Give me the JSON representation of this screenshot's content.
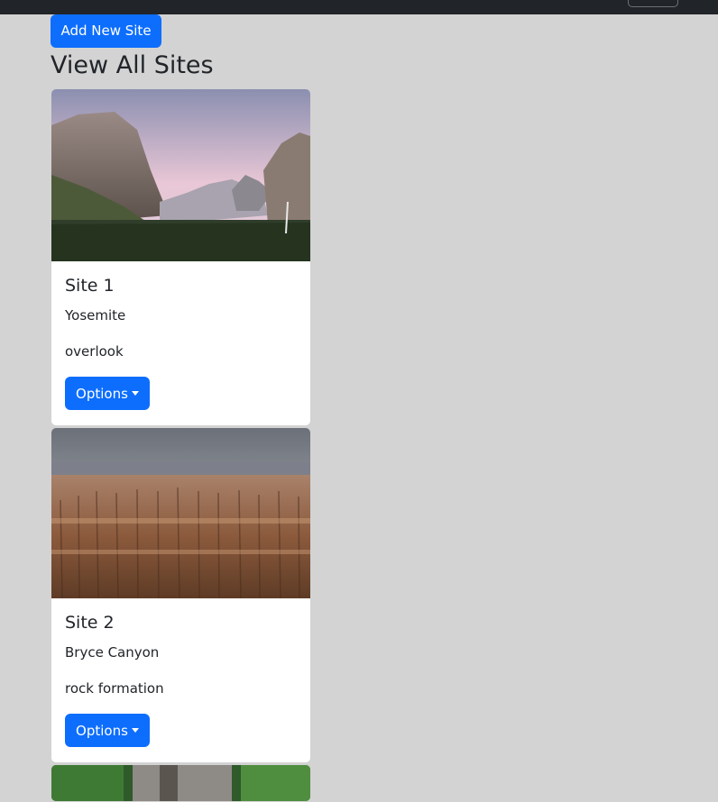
{
  "header": {
    "add_button_label": "Add New Site",
    "page_title": "View All Sites"
  },
  "sites": [
    {
      "title": "Site 1",
      "location": "Yosemite",
      "description": "overlook",
      "options_label": "Options"
    },
    {
      "title": "Site 2",
      "location": "Bryce Canyon",
      "description": "rock formation",
      "options_label": "Options"
    },
    {
      "title": "",
      "location": "",
      "description": "",
      "options_label": ""
    }
  ],
  "colors": {
    "background": "#d3d3d3",
    "navbar": "#212529",
    "primary": "#0d6efd"
  }
}
